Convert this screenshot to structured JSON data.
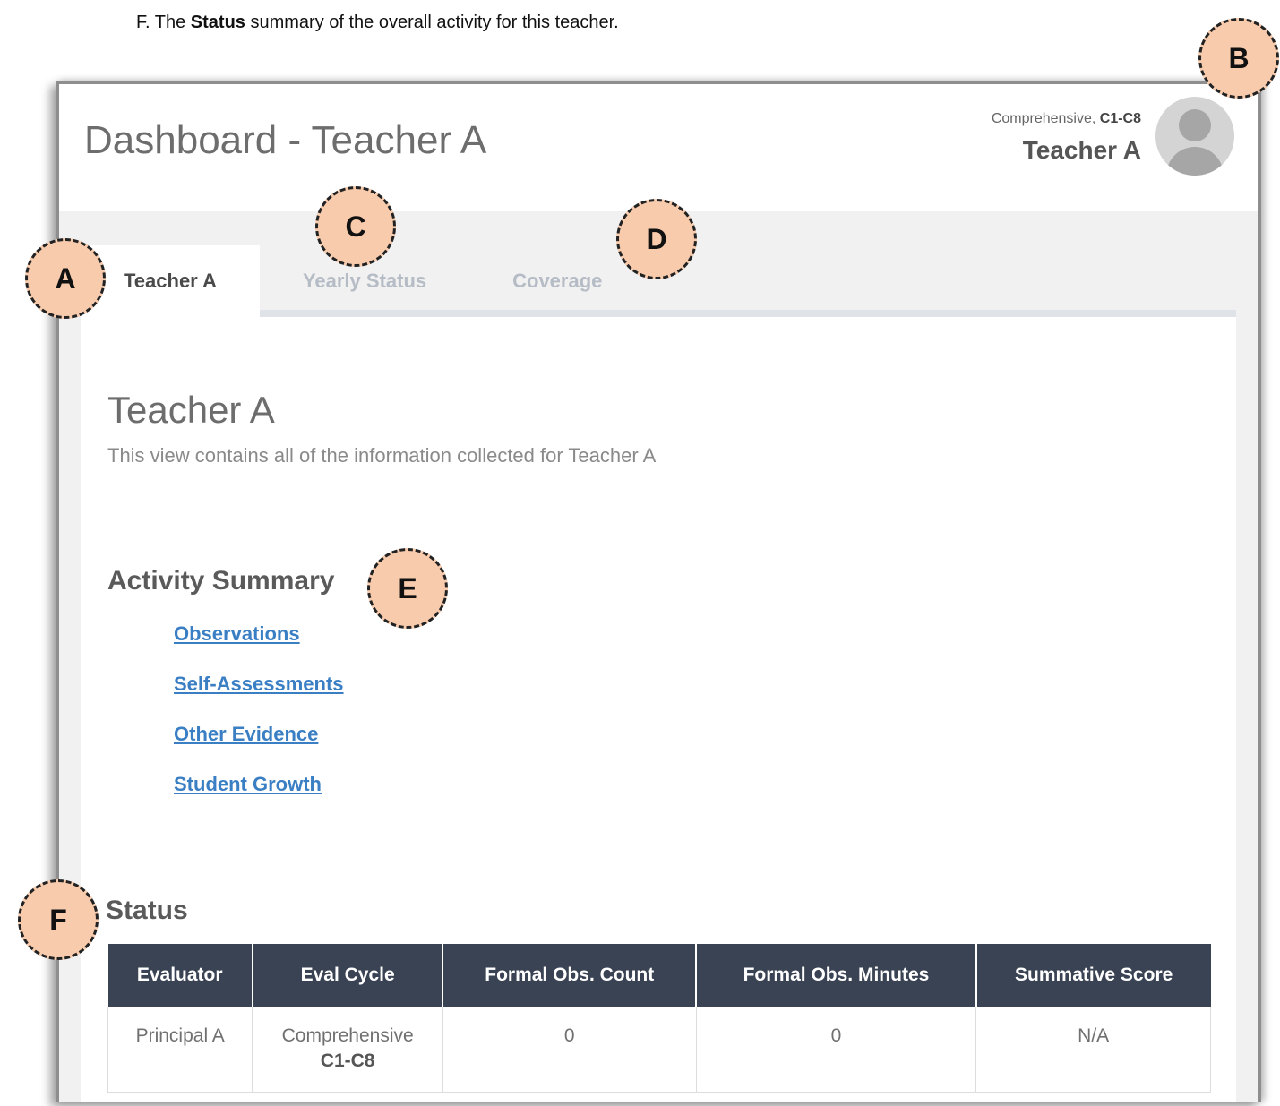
{
  "caption": {
    "prefix": "F.   The ",
    "bold": "Status",
    "suffix": " summary of the overall activity for this teacher."
  },
  "header": {
    "title": "Dashboard - Teacher A",
    "profile": {
      "cycle_prefix": "Comprehensive, ",
      "cycle_bold": "C1-C8",
      "name": "Teacher A"
    }
  },
  "tabs": [
    {
      "label": "Teacher A",
      "active": true
    },
    {
      "label": "Yearly Status",
      "active": false
    },
    {
      "label": "Coverage",
      "active": false
    }
  ],
  "section": {
    "title": "Teacher A",
    "description": "This view contains all of the information collected for Teacher A"
  },
  "activity": {
    "title": "Activity Summary",
    "links": [
      "Observations",
      "Self-Assessments",
      "Other Evidence",
      "Student Growth"
    ]
  },
  "status": {
    "title": "Status",
    "columns": [
      "Evaluator",
      "Eval Cycle",
      "Formal Obs. Count",
      "Formal Obs. Minutes",
      "Summative Score"
    ],
    "row": {
      "evaluator": "Principal A",
      "cycle_line1": "Comprehensive",
      "cycle_line2": "C1-C8",
      "count": "0",
      "minutes": "0",
      "score": "N/A"
    }
  },
  "badges": [
    "A",
    "B",
    "C",
    "D",
    "E",
    "F"
  ],
  "colors": {
    "badge_fill": "#f8cbad",
    "table_header": "#3a4353",
    "link": "#3a7fc4"
  }
}
